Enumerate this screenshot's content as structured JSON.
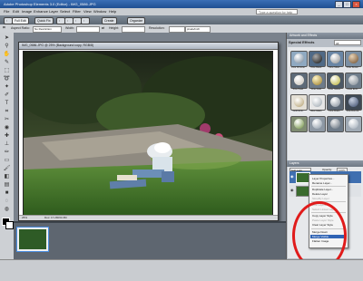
{
  "window": {
    "title": "Adobe Photoshop Elements 3.0 (Editor) - IMG_0586.JPG",
    "controls": [
      "_",
      "□",
      "×"
    ]
  },
  "menubar": {
    "items": [
      "File",
      "Edit",
      "Image",
      "Enhance",
      "Layer",
      "Select",
      "Filter",
      "View",
      "Window",
      "Help"
    ],
    "help_placeholder": "Type a question for help"
  },
  "shortcuts": {
    "buttons": [
      "Full Edit",
      "Quick Fix"
    ],
    "create_label": "Create",
    "organize_label": "Organize"
  },
  "options": {
    "aspect_label": "Aspect Ratio:",
    "aspect_value": "No Restriction",
    "width_label": "Width:",
    "height_label": "Height:",
    "resolution_label": "Resolution:",
    "resolution_unit": "pixels/inch"
  },
  "document": {
    "title": "IMG_0586.JPG @ 25% (Background copy, RGB/8)",
    "zoom": "25%",
    "info": "Doc: 17.2M/34.3M"
  },
  "palettes": {
    "effects_header": "Artwork and Effects",
    "special_effects_title": "Special Effects",
    "effects_filter": "All",
    "effects": [
      "Fine Chrome",
      "Fine Black",
      "Fine Silver",
      "Fine Brown",
      "Fine Pearl",
      "Fine Gold",
      "Fine Yellow",
      "Clear Emb.",
      "Gold Emb.",
      "Blue Glass",
      "Fine Brass",
      "Fine Bronze"
    ],
    "layers_header": "Layers",
    "blend_mode": "Soft Light",
    "opacity_label": "Opacity:",
    "opacity_value": "100%",
    "layer_name": "Background copy"
  },
  "context_menu": {
    "items": [
      {
        "label": "Layer Properties...",
        "disabled": false
      },
      {
        "label": "Rename Layer...",
        "disabled": false
      },
      {
        "label": "Duplicate Layer...",
        "disabled": false
      },
      {
        "label": "Delete Layer",
        "disabled": false
      },
      {
        "label": "Simplify Layer",
        "disabled": true
      },
      {
        "label": "Link Layers",
        "disabled": true
      },
      {
        "label": "Select Linked Layers",
        "disabled": true
      },
      {
        "label": "Copy Layer Style",
        "disabled": false
      },
      {
        "label": "Paste Layer Style",
        "disabled": true
      },
      {
        "label": "Clear Layer Style",
        "disabled": false
      },
      {
        "label": "Merge Down",
        "disabled": false
      },
      {
        "label": "Merge Visible",
        "disabled": false,
        "selected": true
      },
      {
        "label": "Flatten Image",
        "disabled": false
      }
    ]
  },
  "colors": {
    "highlight_circle": "#e01b1b",
    "selection": "#2f63b4"
  }
}
